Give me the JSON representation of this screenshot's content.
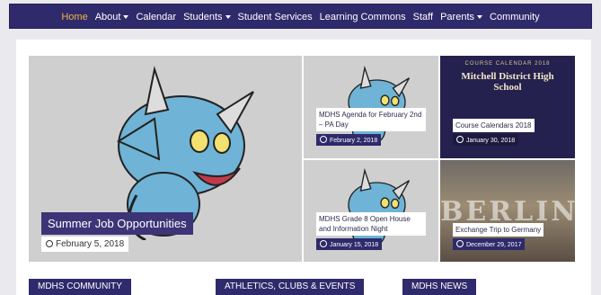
{
  "nav": {
    "items": [
      {
        "label": "Home",
        "active": true,
        "dropdown": false
      },
      {
        "label": "About",
        "active": false,
        "dropdown": true
      },
      {
        "label": "Calendar",
        "active": false,
        "dropdown": false
      },
      {
        "label": "Students",
        "active": false,
        "dropdown": true
      },
      {
        "label": "Student Services",
        "active": false,
        "dropdown": false
      },
      {
        "label": "Learning Commons",
        "active": false,
        "dropdown": false
      },
      {
        "label": "Staff",
        "active": false,
        "dropdown": false
      },
      {
        "label": "Parents",
        "active": false,
        "dropdown": true
      },
      {
        "label": "Community",
        "active": false,
        "dropdown": false
      }
    ]
  },
  "featured": {
    "main": {
      "title": "Summer Job Opportunities",
      "date": "February 5, 2018"
    },
    "r1": {
      "title": "MDHS Agenda for February 2nd – PA Day",
      "date": "February 2, 2018"
    },
    "r2": {
      "title": "MDHS Grade 8 Open House and Information Night",
      "date": "January 15, 2018"
    },
    "cal": {
      "title": "Course Calendars 2018",
      "date": "January 30, 2018",
      "image_small": "COURSE CALENDAR 2018",
      "image_big": "Mitchell District High School"
    },
    "berlin": {
      "title": "Exchange Trip to Germany",
      "date": "December 29, 2017",
      "image_word": "BERLIN"
    }
  },
  "sections": [
    "MDHS COMMUNITY",
    "ATHLETICS, CLUBS & EVENTS",
    "MDHS NEWS"
  ],
  "colors": {
    "nav_bg": "#2e2a6b",
    "accent": "#f0b64a",
    "mascot": "#6fb3d6"
  }
}
